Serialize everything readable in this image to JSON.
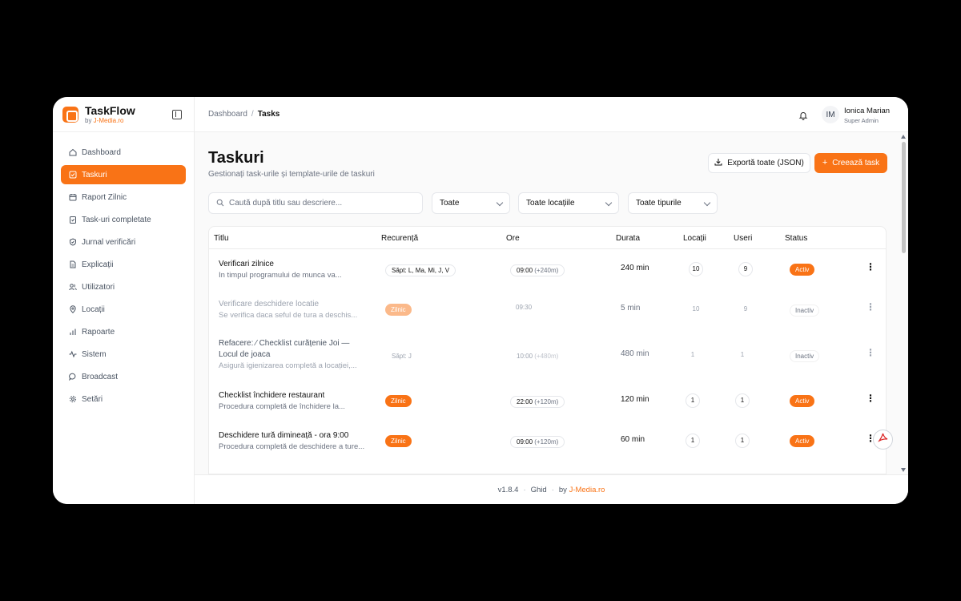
{
  "brand": {
    "name": "TaskFlow",
    "by_prefix": "by ",
    "by_name": "J-Media.ro"
  },
  "sidebar": {
    "items": [
      {
        "label": "Dashboard",
        "icon": "home-icon",
        "active": false
      },
      {
        "label": "Taskuri",
        "icon": "checkbox-icon",
        "active": true
      },
      {
        "label": "Raport Zilnic",
        "icon": "calendar-icon",
        "active": false
      },
      {
        "label": "Task-uri completate",
        "icon": "clipboard-check-icon",
        "active": false
      },
      {
        "label": "Jurnal verificări",
        "icon": "shield-icon",
        "active": false
      },
      {
        "label": "Explicații",
        "icon": "document-icon",
        "active": false
      },
      {
        "label": "Utilizatori",
        "icon": "users-icon",
        "active": false
      },
      {
        "label": "Locații",
        "icon": "map-pin-icon",
        "active": false
      },
      {
        "label": "Rapoarte",
        "icon": "bar-chart-icon",
        "active": false
      },
      {
        "label": "Sistem",
        "icon": "activity-icon",
        "active": false
      },
      {
        "label": "Broadcast",
        "icon": "message-icon",
        "active": false
      },
      {
        "label": "Setări",
        "icon": "gear-icon",
        "active": false
      }
    ]
  },
  "breadcrumb": {
    "parent": "Dashboard",
    "separator": "/",
    "current": "Tasks"
  },
  "user": {
    "initials": "IM",
    "name": "Ionica Marian",
    "role": "Super Admin"
  },
  "page": {
    "title": "Taskuri",
    "subtitle": "Gestionați task-urile și template-urile de taskuri"
  },
  "actions": {
    "export_label": "Exportă toate (JSON)",
    "create_label": "Creează task"
  },
  "filters": {
    "search_placeholder": "Caută după titlu sau descriere...",
    "status_value": "Toate",
    "location_value": "Toate locațiile",
    "type_value": "Toate tipurile"
  },
  "table": {
    "columns": {
      "title": "Titlu",
      "recurrence": "Recurență",
      "hours": "Ore",
      "duration": "Durata",
      "locations": "Locații",
      "users": "Useri",
      "status": "Status"
    },
    "rows": [
      {
        "title": "Verificari zilnice",
        "description": "In timpul programului de munca va...",
        "recurrence": "Săpt: L, Ma, Mi, J, V",
        "time": "09:00",
        "time_extra": "(+240m)",
        "duration": "240 min",
        "locations": "10",
        "users": "9",
        "status": "Activ"
      },
      {
        "title": "Verificare deschidere locatie",
        "description": "Se verifica daca seful de tura a deschis...",
        "recurrence": "Zilnic",
        "time": "09:30",
        "time_extra": "",
        "duration": "5 min",
        "locations": "10",
        "users": "9",
        "status": "Inactiv"
      },
      {
        "title_line1": "Refacere: ⁄ Checklist curățenie Joi —",
        "title_line2": "Locul de joaca",
        "description": "Asigură igienizarea completă a locației,...",
        "recurrence": "Săpt: J",
        "time": "10:00",
        "time_extra": "(+480m)",
        "duration": "480 min",
        "locations": "1",
        "users": "1",
        "status": "Inactiv"
      },
      {
        "title": "Checklist închidere restaurant",
        "description": "Procedura completă de închidere la...",
        "recurrence": "Zilnic",
        "time": "22:00",
        "time_extra": "(+120m)",
        "duration": "120 min",
        "locations": "1",
        "users": "1",
        "status": "Activ"
      },
      {
        "title": "Deschidere tură dimineață - ora 9:00",
        "description": "Procedura completă de deschidere a ture...",
        "recurrence": "Zilnic",
        "time": "09:00",
        "time_extra": "(+120m)",
        "duration": "60 min",
        "locations": "1",
        "users": "1",
        "status": "Activ"
      }
    ]
  },
  "footer": {
    "version": "v1.8.4",
    "guide": "Ghid",
    "by": "by",
    "brand": "J-Media.ro",
    "dot": "·"
  },
  "colors": {
    "accent": "#f97316",
    "accent_faded": "#fbb98a",
    "background": "#000000"
  }
}
